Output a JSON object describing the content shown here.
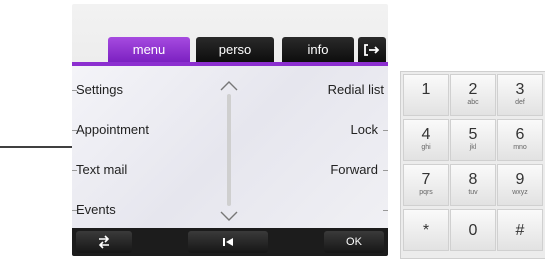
{
  "tabs": [
    {
      "label": "menu",
      "active": true
    },
    {
      "label": "perso",
      "active": false
    },
    {
      "label": "info",
      "active": false
    }
  ],
  "exit_icon": "exit-arrow-icon",
  "menu_rows": [
    {
      "left": "Settings",
      "right": "Redial list"
    },
    {
      "left": "Appointment",
      "right": "Lock"
    },
    {
      "left": "Text mail",
      "right": "Forward"
    },
    {
      "left": "Events",
      "right": ""
    }
  ],
  "softkeys": {
    "left_icon": "swap-icon",
    "middle_icon": "skip-back-icon",
    "right_label": "OK"
  },
  "keypad": [
    {
      "digit": "1",
      "letters": ""
    },
    {
      "digit": "2",
      "letters": "abc"
    },
    {
      "digit": "3",
      "letters": "def"
    },
    {
      "digit": "4",
      "letters": "ghi"
    },
    {
      "digit": "5",
      "letters": "jkl"
    },
    {
      "digit": "6",
      "letters": "mno"
    },
    {
      "digit": "7",
      "letters": "pqrs"
    },
    {
      "digit": "8",
      "letters": "tuv"
    },
    {
      "digit": "9",
      "letters": "wxyz"
    },
    {
      "digit": "*",
      "letters": ""
    },
    {
      "digit": "0",
      "letters": ""
    },
    {
      "digit": "#",
      "letters": ""
    }
  ],
  "colors": {
    "active_tab": "#8c2fd0",
    "tab_dark": "#111111"
  }
}
